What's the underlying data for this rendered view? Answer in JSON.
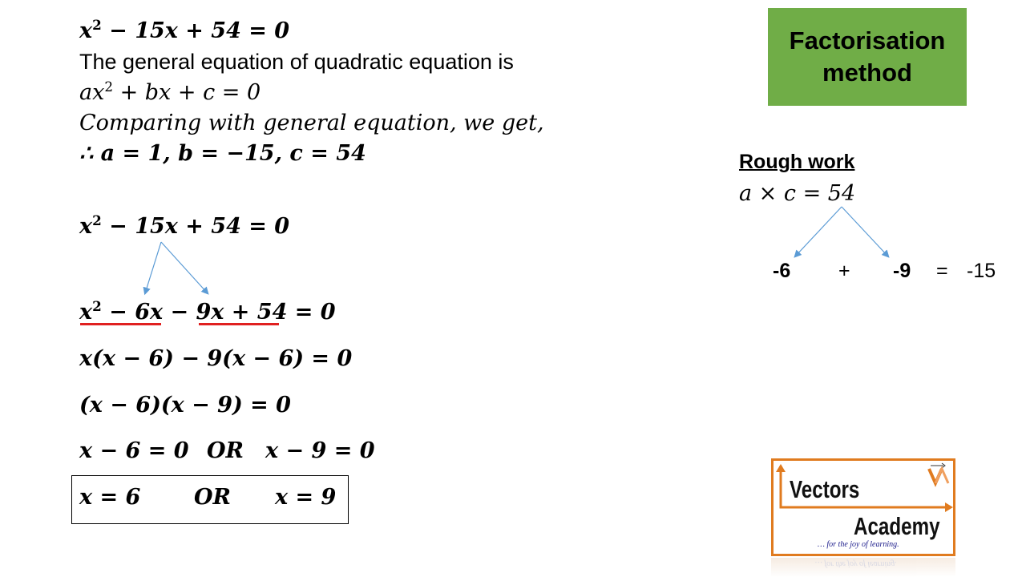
{
  "title_box": {
    "line1": "Factorisation",
    "line2": "method",
    "color": "#70AD47"
  },
  "intro": {
    "equation": {
      "x": "x",
      "exp": "2",
      "rest": " − 15x + 54 = 0"
    },
    "general_text": "The general equation of quadratic equation is",
    "general_eq": {
      "a": "ax",
      "exp": "2",
      "rest": " + bx + c = 0"
    },
    "comparing": "Comparing with general equation, we get,",
    "coefficients": "∴ a = 1, b = −15, c = 54"
  },
  "steps": {
    "step1": {
      "x": "x",
      "exp": "2",
      "rest": " − 15x + 54 = 0"
    },
    "step2": {
      "x": "x",
      "exp": "2",
      "rest": " − 6x − 9x + 54 = 0"
    },
    "step3": "x(x − 6) − 9(x − 6) = 0",
    "step4": "(x − 6)(x − 9) = 0",
    "step5_left": "x − 6 = 0",
    "step5_or": "OR",
    "step5_right": "x − 9 = 0",
    "answer_left": "x = 6",
    "answer_or": "OR",
    "answer_right": "x = 9"
  },
  "rough_work": {
    "title": "Rough work",
    "product": "a × c = 54",
    "factor1": "-6",
    "plus": "+",
    "factor2": "-9",
    "equals": "=",
    "sum": "-15"
  },
  "colors": {
    "underline": "#E02020",
    "arrow": "#5B9BD5",
    "logo_orange": "#E07B1F"
  },
  "logo": {
    "word1": "Vectors",
    "word2": "Academy",
    "tagline": "… for the joy of learning.",
    "mark": "VA"
  }
}
